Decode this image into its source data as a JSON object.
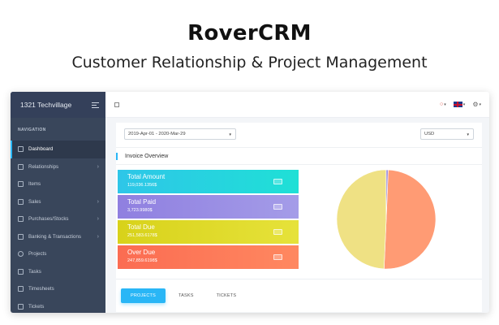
{
  "hero": {
    "title": "RoverCRM",
    "subtitle": "Customer Relationship & Project Management"
  },
  "sidebar": {
    "brand": "1321 Techvillage",
    "section": "NAVIGATION",
    "items": [
      {
        "label": "Dashboard",
        "icon": "home-icon",
        "active": true,
        "has_children": false
      },
      {
        "label": "Relationships",
        "icon": "users-icon",
        "active": false,
        "has_children": true
      },
      {
        "label": "Items",
        "icon": "box-icon",
        "active": false,
        "has_children": false
      },
      {
        "label": "Sales",
        "icon": "sales-icon",
        "active": false,
        "has_children": true
      },
      {
        "label": "Purchases/Stocks",
        "icon": "cart-icon",
        "active": false,
        "has_children": true
      },
      {
        "label": "Banking & Transactions",
        "icon": "bank-icon",
        "active": false,
        "has_children": true
      },
      {
        "label": "Projects",
        "icon": "projects-icon",
        "active": false,
        "has_children": false
      },
      {
        "label": "Tasks",
        "icon": "tasks-icon",
        "active": false,
        "has_children": false
      },
      {
        "label": "Timesheets",
        "icon": "calendar-icon",
        "active": false,
        "has_children": false
      },
      {
        "label": "Tickets",
        "icon": "ticket-icon",
        "active": false,
        "has_children": false
      }
    ],
    "chevron": "›"
  },
  "topbar": {
    "bell_glyph": "○",
    "caret_glyph": "▾",
    "gear_glyph": "⚙"
  },
  "filters": {
    "date_range": "2019-Apr-01 - 2020-Mar-29",
    "currency": "USD",
    "arrow_glyph": "▼"
  },
  "invoice": {
    "title": "Invoice Overview",
    "stats": [
      {
        "name": "Total Amount",
        "value": "119,036.1356$"
      },
      {
        "name": "Total Paid",
        "value": "3,723.9980$"
      },
      {
        "name": "Total Due",
        "value": "251,583.6178$"
      },
      {
        "name": "Over Due",
        "value": "247,859.6198$"
      }
    ]
  },
  "chart_data": {
    "type": "pie",
    "slices": [
      {
        "value": 0.5006,
        "color": "#ff9b74"
      },
      {
        "value": 0.4928,
        "color": "#efe184"
      },
      {
        "value": 0.0066,
        "color": "#9c8fe0"
      }
    ]
  },
  "colors": {
    "accent": "#29b6f6",
    "sidebar_bg": "#39465b"
  },
  "tabs": [
    {
      "label": "PROJECTS",
      "active": true
    },
    {
      "label": "TASKS",
      "active": false
    },
    {
      "label": "TICKETS",
      "active": false
    }
  ]
}
